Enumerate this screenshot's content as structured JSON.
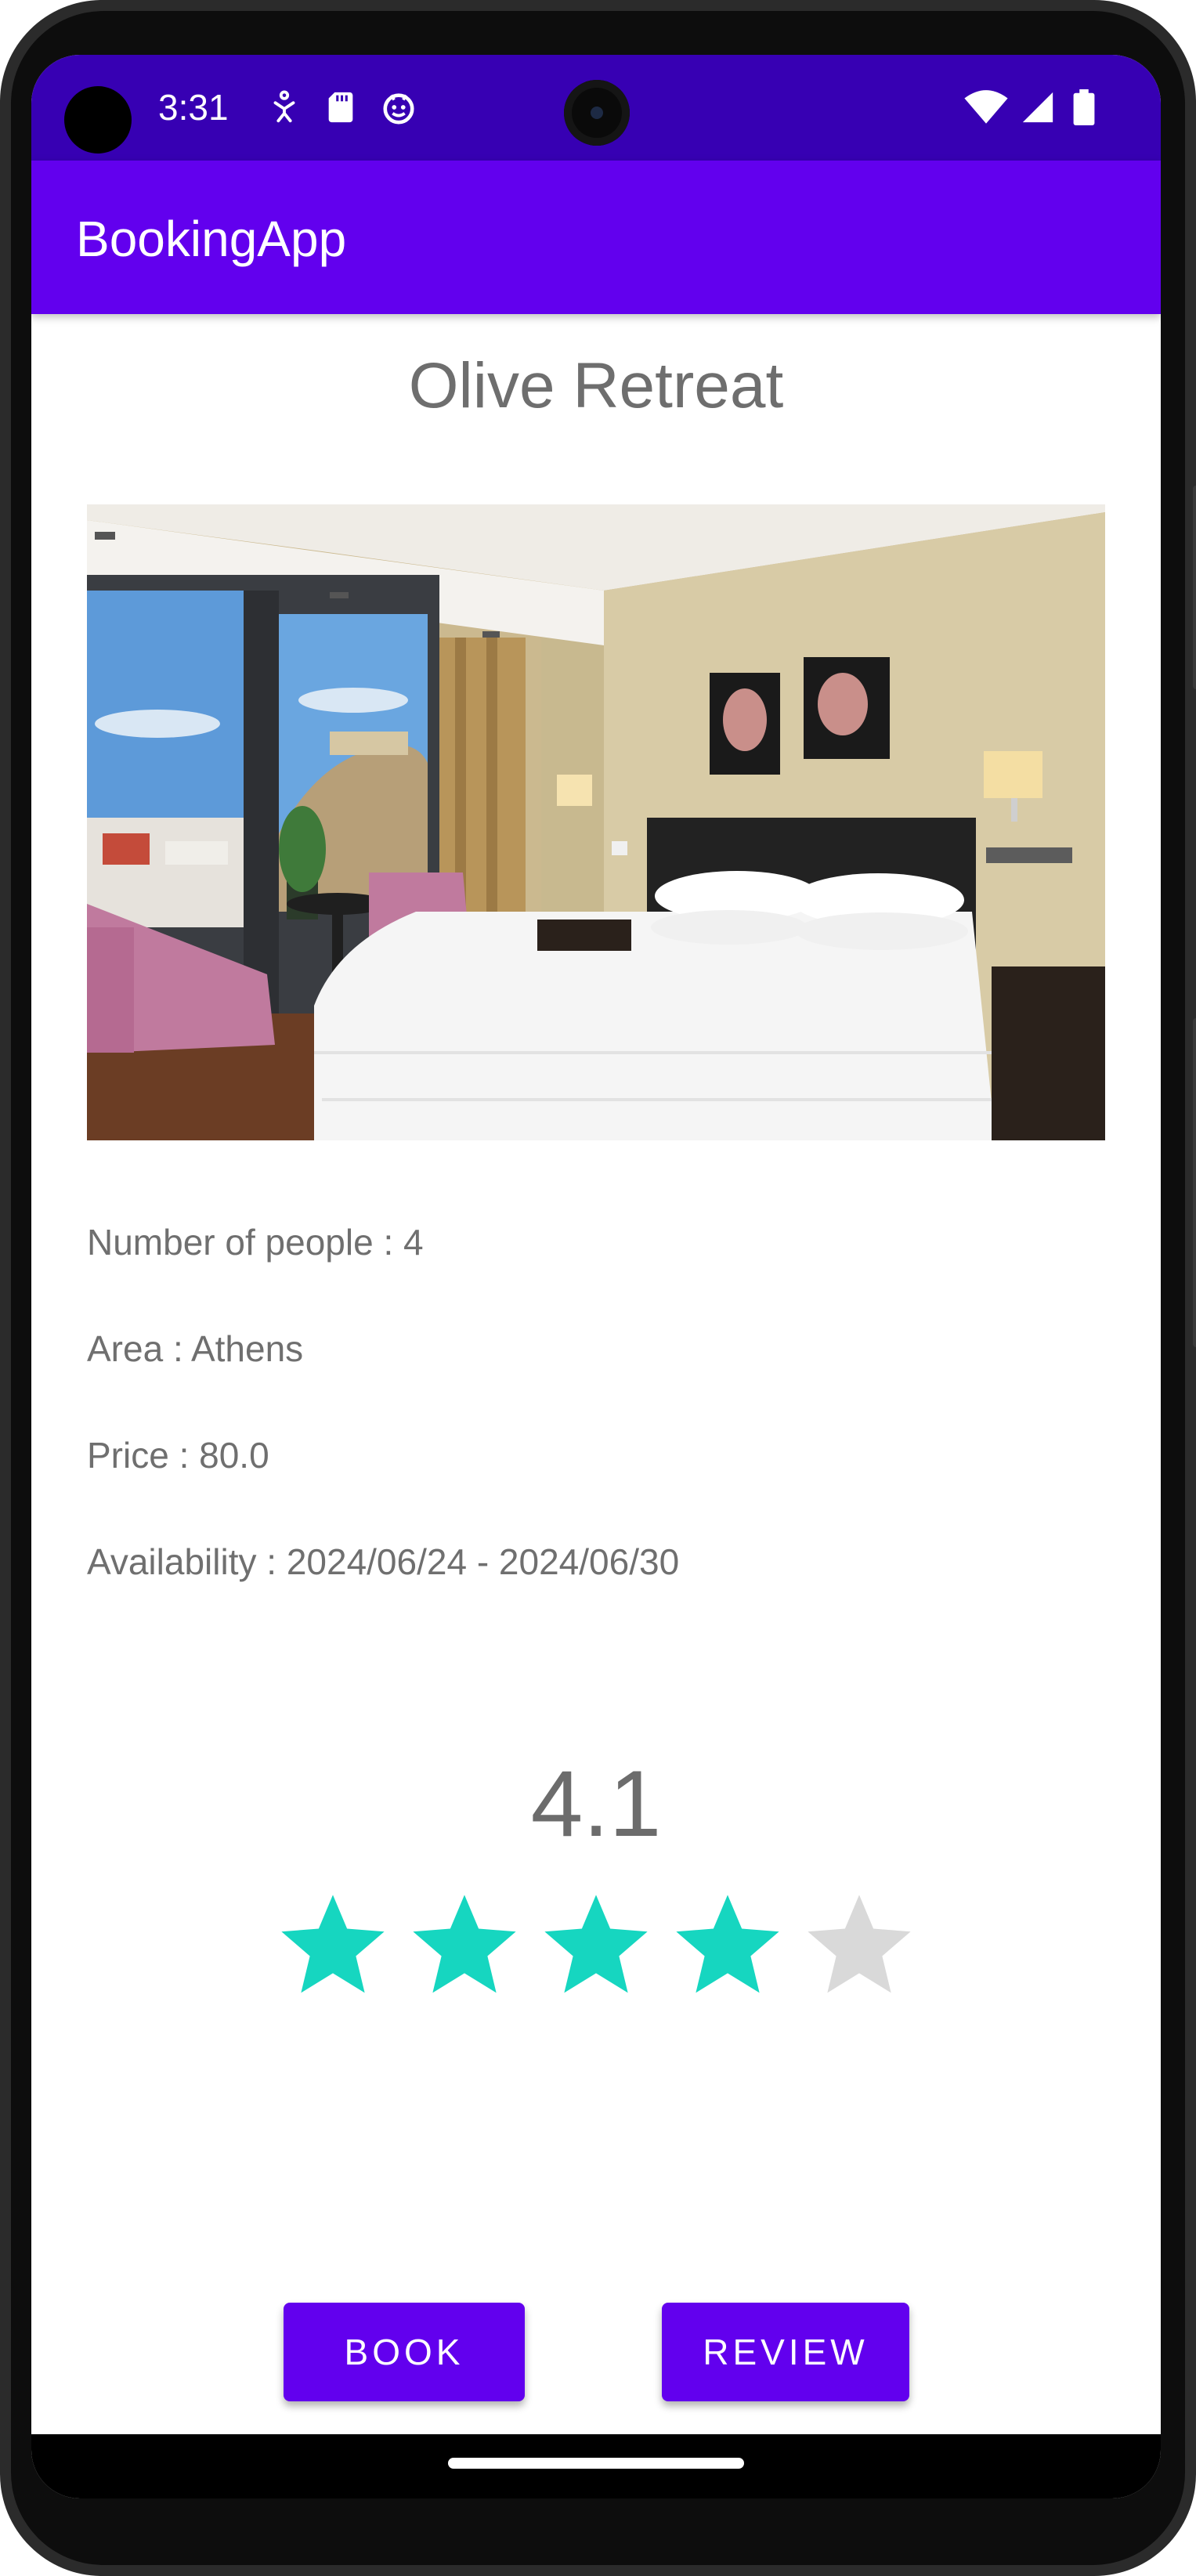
{
  "status_bar": {
    "time": "3:31",
    "left_icons": [
      "accessibility-icon",
      "sd-card-icon",
      "android-debug-icon"
    ],
    "right_icons": [
      "wifi-icon",
      "signal-icon",
      "battery-icon"
    ],
    "background_color": "#3700b3"
  },
  "app_bar": {
    "title": "BookingApp",
    "background_color": "#6200ee"
  },
  "hotel": {
    "name": "Olive Retreat",
    "photo_description_icon": "hotel-room-photo",
    "details": [
      "Number of people : 4",
      "Area : Athens",
      "Price : 80.0",
      "Availability : 2024/06/24 - 2024/06/30"
    ],
    "rating": {
      "value": "4.1",
      "max_stars": 5,
      "filled_stars": 4,
      "filled_color": "#16d6c0",
      "empty_color": "#d9d9d9"
    }
  },
  "actions": {
    "book_label": "BOOK",
    "review_label": "REVIEW"
  }
}
